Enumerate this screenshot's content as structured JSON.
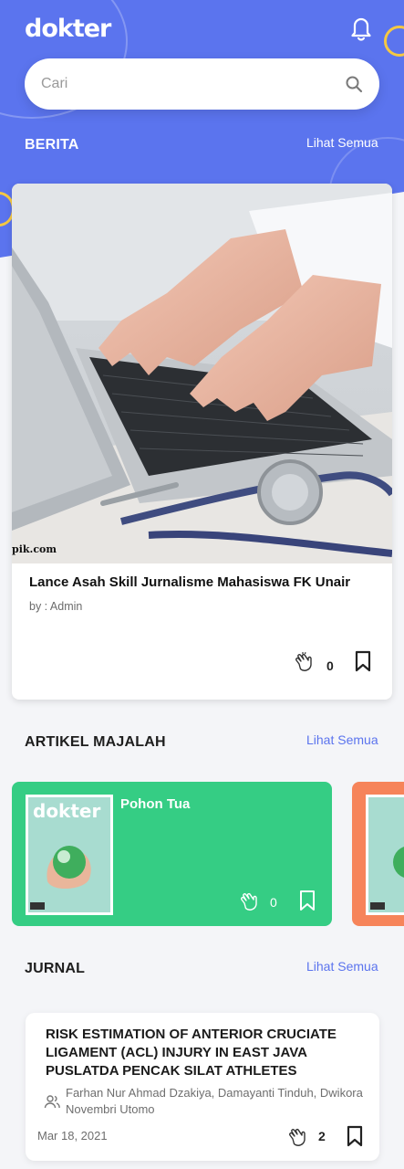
{
  "app": {
    "logo": "dokter"
  },
  "search": {
    "placeholder": "Cari"
  },
  "sections": {
    "news": {
      "title": "BERITA",
      "see_all": "Lihat Semua"
    },
    "magazine": {
      "title": "ARTIKEL MAJALAH",
      "see_all": "Lihat Semua"
    },
    "journal": {
      "title": "JURNAL",
      "see_all": "Lihat Semua"
    }
  },
  "news_card": {
    "image_watermark": "pik.com",
    "title": "Lance Asah Skill Jurnalisme Mahasiswa FK Unair",
    "author": "by : Admin",
    "claps": "0"
  },
  "magazine_card": {
    "cover_logo": "dokter",
    "title": "Pohon Tua",
    "claps": "0"
  },
  "journal_card": {
    "title": "RISK ESTIMATION OF ANTERIOR CRUCIATE LIGAMENT (ACL) INJURY IN EAST JAVA PUSLATDA PENCAK SILAT ATHLETES",
    "authors": "Farhan Nur Ahmad Dzakiya, Damayanti Tinduh, Dwikora Novembri Utomo",
    "date": "Mar 18, 2021",
    "claps": "2"
  },
  "colors": {
    "primary": "#5b74ee",
    "accent_yellow": "#f5c842",
    "magazine_green": "#35cd84",
    "magazine_orange": "#f6845a",
    "link": "#5b74ee"
  },
  "icons": [
    "bell-icon",
    "search-icon",
    "clap-icon",
    "bookmark-icon",
    "people-icon"
  ]
}
